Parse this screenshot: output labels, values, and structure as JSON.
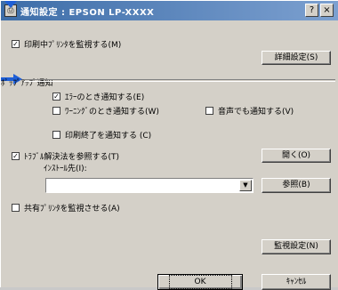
{
  "window": {
    "title": "通知設定 : EPSON LP-XXXX",
    "help_button": "?",
    "close_button": "×"
  },
  "monitor_printing": {
    "label": "印刷中ﾌﾟﾘﾝﾀを監視する(M)",
    "checked": true
  },
  "detail_settings_button": "詳細設定(S)",
  "popup_section": {
    "heading": "ﾎﾟｯﾌﾟｱｯﾌﾟ通知",
    "error_notify": {
      "label": "ｴﾗｰのとき通知する(E)",
      "checked": true
    },
    "warning_notify": {
      "label": "ﾜｰﾆﾝｸﾞのとき通知する(W)",
      "checked": false
    },
    "sound_notify": {
      "label": "音声でも通知する(V)",
      "checked": false
    },
    "print_end_notify": {
      "label": "印刷終了を通知する (C)",
      "checked": false
    }
  },
  "troubleshoot": {
    "label": "ﾄﾗﾌﾞﾙ解決法を参照する(T)",
    "checked": true,
    "open_button": "開く(O)",
    "install_dest_label": "ｲﾝｽﾄｰﾙ先(I):",
    "install_dest_value": "",
    "browse_button": "参照(B)"
  },
  "shared_printer": {
    "label": "共有ﾌﾟﾘﾝﾀを監視させる(A)",
    "checked": false
  },
  "monitor_settings_button": "監視設定(N)",
  "ok_button": "OK",
  "cancel_button": "ｷｬﾝｾﾙ",
  "colors": {
    "title_bar_start": "#3d6da8",
    "title_bar_end": "#7ca0d0",
    "dialog_bg": "#d4d0c8",
    "annotation_arrow": "#1f5fd6"
  },
  "icons": {
    "window_icon": "printer-settings-icon",
    "check_mark": "check-icon",
    "dropdown": "chevron-down-icon"
  }
}
